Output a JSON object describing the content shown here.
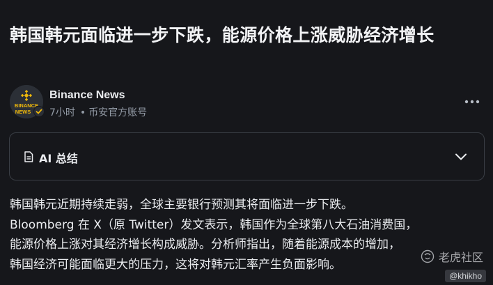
{
  "article": {
    "title": "韩国韩元面临进一步下跌，能源价格上涨威胁经济增长"
  },
  "author": {
    "name": "Binance News",
    "avatar_text_line1": "BINANCE",
    "avatar_text_line2": "NEWS",
    "time": "7小时",
    "separator": "•",
    "account_type": "币安官方账号",
    "more_icon": "more-horizontal-icon"
  },
  "ai_summary": {
    "label": "AI 总结",
    "doc_icon": "document-icon",
    "toggle_icon": "chevron-down-icon"
  },
  "body": {
    "lines": [
      "韩国韩元近期持续走弱，全球主要银行预测其将面临进一步下跌。",
      "Bloomberg 在 X（原 Twitter）发文表示，韩国作为全球第八大石油消费国，",
      "能源价格上涨对其经济增长构成威胁。分析师指出，随着能源成本的增加，",
      "韩国经济可能面临更大的压力，这将对韩元汇率产生负面影响。"
    ]
  },
  "watermark": {
    "text": "老虎社区",
    "handle": "@khikho"
  },
  "colors": {
    "background": "#16171b",
    "text_primary": "#eaecef",
    "text_secondary": "#929aa5",
    "brand_yellow": "#f0b90b",
    "border": "#3a3e45"
  }
}
